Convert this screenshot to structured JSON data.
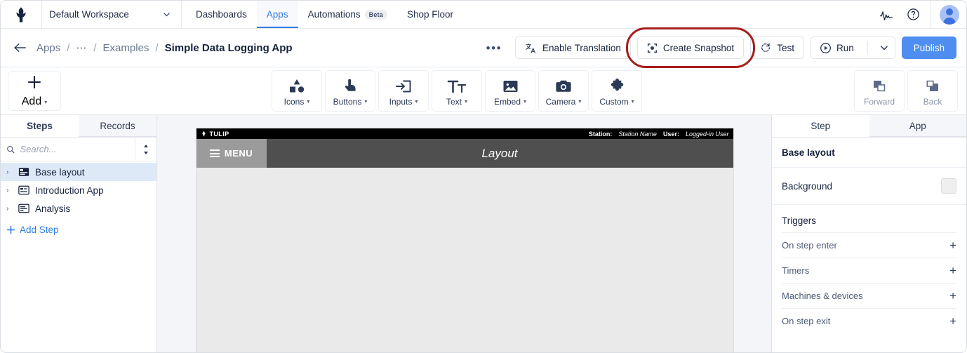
{
  "topnav": {
    "logo_icon": "tulip-logo-icon",
    "workspace": {
      "label": "Default Workspace",
      "caret": "⌄"
    },
    "tabs": [
      {
        "label": "Dashboards",
        "active": false
      },
      {
        "label": "Apps",
        "active": true
      },
      {
        "label": "Automations",
        "badge": "Beta",
        "active": false
      },
      {
        "label": "Shop Floor",
        "active": false
      }
    ],
    "activity_icon": "activity-pulse-icon",
    "help_icon": "help-circle-icon",
    "avatar_icon": "user-avatar"
  },
  "breadcrumb": {
    "back_icon": "back-arrow-icon",
    "items": [
      {
        "label": "Apps",
        "current": false
      },
      {
        "label": "⋯",
        "current": false
      },
      {
        "label": "Examples",
        "current": false
      },
      {
        "label": "Simple Data Logging App",
        "current": true
      }
    ],
    "separator": "/"
  },
  "actions": {
    "overflow_label": "•••",
    "enable_translation": {
      "label": "Enable Translation",
      "icon": "translate-icon"
    },
    "create_snapshot": {
      "label": "Create Snapshot",
      "icon": "snapshot-focus-icon",
      "highlighted": true
    },
    "test": {
      "label": "Test",
      "icon": "refresh-dashed-icon"
    },
    "run": {
      "label": "Run",
      "icon": "play-circle-icon",
      "caret": "▾"
    },
    "publish": {
      "label": "Publish"
    },
    "highlight_color": "#a71d1d",
    "publish_color": "#4d8ef0"
  },
  "widget_toolbar": {
    "add": {
      "label": "Add",
      "icon": "plus-icon",
      "caret": "▾"
    },
    "items": [
      {
        "label": "Icons",
        "icon": "shapes-icon",
        "caret": "▾"
      },
      {
        "label": "Buttons",
        "icon": "pointer-hand-icon",
        "caret": "▾"
      },
      {
        "label": "Inputs",
        "icon": "input-arrow-icon",
        "caret": "▾"
      },
      {
        "label": "Text",
        "icon": "text-tt-icon",
        "caret": "▾"
      },
      {
        "label": "Embed",
        "icon": "image-icon",
        "caret": "▾"
      },
      {
        "label": "Camera",
        "icon": "camera-icon",
        "caret": "▾"
      },
      {
        "label": "Custom",
        "icon": "puzzle-piece-icon",
        "caret": "▾"
      }
    ],
    "arrange": [
      {
        "label": "Forward",
        "icon": "bring-forward-icon",
        "disabled": true
      },
      {
        "label": "Back",
        "icon": "send-back-icon",
        "disabled": true
      }
    ]
  },
  "left_panel": {
    "tabs": [
      {
        "label": "Steps",
        "active": true
      },
      {
        "label": "Records",
        "active": false
      }
    ],
    "search": {
      "placeholder": "Search...",
      "value": "",
      "icon": "search-icon"
    },
    "sort_icon": "sort-updown-icon",
    "steps": [
      {
        "label": "Base layout",
        "icon": "step-layout-icon",
        "selected": true,
        "chevron": "›"
      },
      {
        "label": "Introduction App",
        "icon": "step-icon",
        "selected": false,
        "chevron": "›"
      },
      {
        "label": "Analysis",
        "icon": "step-icon",
        "selected": false,
        "chevron": "›"
      }
    ],
    "add_step": {
      "label": "Add Step",
      "icon": "plus-icon"
    }
  },
  "canvas": {
    "status_bar": {
      "brand": "TULIP",
      "brand_icon": "tulip-logo-icon",
      "station_label": "Station:",
      "station_value": "Station Name",
      "user_label": "User:",
      "user_value": "Logged-in User"
    },
    "menu_button": {
      "label": "MENU",
      "icon": "hamburger-icon"
    },
    "step_title": "Layout"
  },
  "right_panel": {
    "tabs": [
      {
        "label": "Step",
        "active": true
      },
      {
        "label": "App",
        "active": false
      }
    ],
    "step_name": "Base layout",
    "background": {
      "label": "Background",
      "swatch_color": "#efeff0"
    },
    "triggers_title": "Triggers",
    "triggers": [
      {
        "label": "On step enter",
        "add": "+"
      },
      {
        "label": "Timers",
        "add": "+"
      },
      {
        "label": "Machines & devices",
        "add": "+"
      },
      {
        "label": "On step exit",
        "add": "+"
      }
    ]
  }
}
